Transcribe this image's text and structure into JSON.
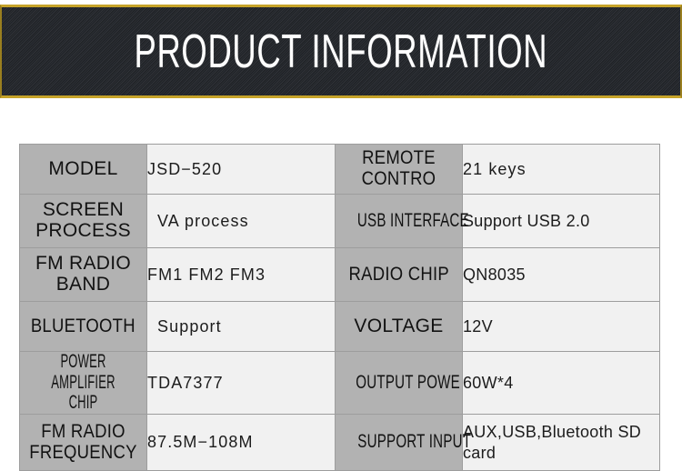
{
  "banner": {
    "title": "PRODUCT INFORMATION",
    "background_color": "#24272c",
    "border_color": "#c6a329",
    "title_color": "#ffffff"
  },
  "table": {
    "label_bg": "#b2b2b2",
    "value_bg": "#f1f1f1",
    "border_color": "#9d9d9d",
    "rows": [
      {
        "left_label": "MODEL",
        "left_value": "JSD−520",
        "right_label": "REMOTE CONTRO",
        "right_value": "21 keys"
      },
      {
        "left_label": "SCREEN PROCESS",
        "left_value": "VA process",
        "right_label": "USB INTERFACE",
        "right_value": "Support USB 2.0"
      },
      {
        "left_label": "FM RADIO BAND",
        "left_value": "FM1 FM2 FM3",
        "right_label": "RADIO CHIP",
        "right_value": "QN8035"
      },
      {
        "left_label": "BLUETOOTH",
        "left_value": "Support",
        "right_label": "VOLTAGE",
        "right_value": "12V"
      },
      {
        "left_label": "POWER AMPLIFIER CHIP",
        "left_value": "TDA7377",
        "right_label": "OUTPUT POWE",
        "right_value": "60W*4"
      },
      {
        "left_label": "FM RADIO FREQUENCY",
        "left_value": "87.5M−108M",
        "right_label": "SUPPORT INPUT",
        "right_value": "AUX,USB,Bluetooth SD card"
      }
    ]
  }
}
